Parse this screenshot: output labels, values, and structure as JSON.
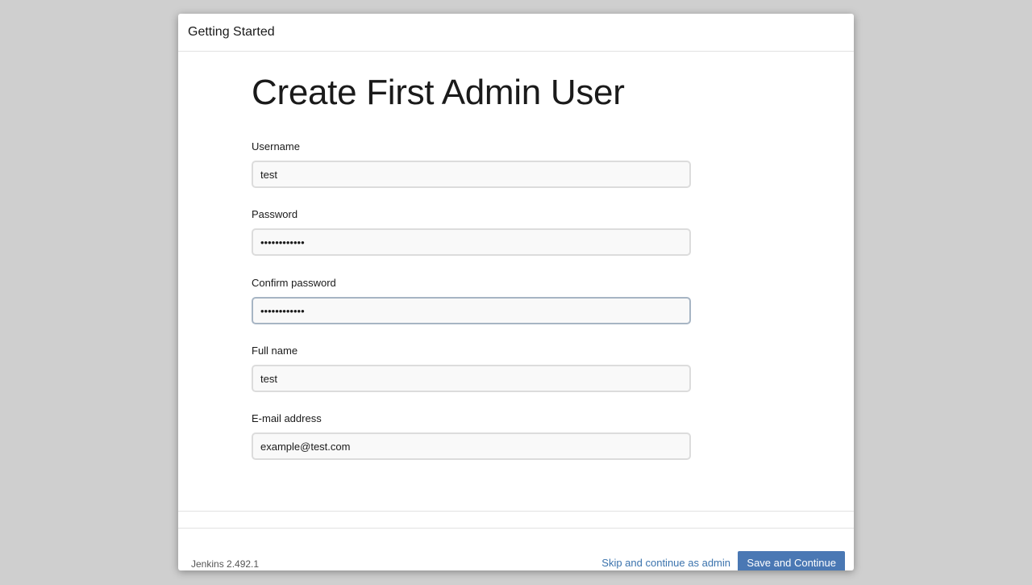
{
  "dialog": {
    "title": "Getting Started"
  },
  "page": {
    "title": "Create First Admin User"
  },
  "form": {
    "username": {
      "label": "Username",
      "value": "test"
    },
    "password": {
      "label": "Password",
      "value": "••••••••••••"
    },
    "confirm_password": {
      "label": "Confirm password",
      "value": "••••••••••••"
    },
    "full_name": {
      "label": "Full name",
      "value": "test"
    },
    "email": {
      "label": "E-mail address",
      "value": "example@test.com"
    }
  },
  "footer": {
    "version": "Jenkins 2.492.1",
    "skip_label": "Skip and continue as admin",
    "save_label": "Save and Continue"
  },
  "colors": {
    "background": "#cfcfcf",
    "primary_button": "#4a78b4",
    "link": "#3b73ad"
  }
}
